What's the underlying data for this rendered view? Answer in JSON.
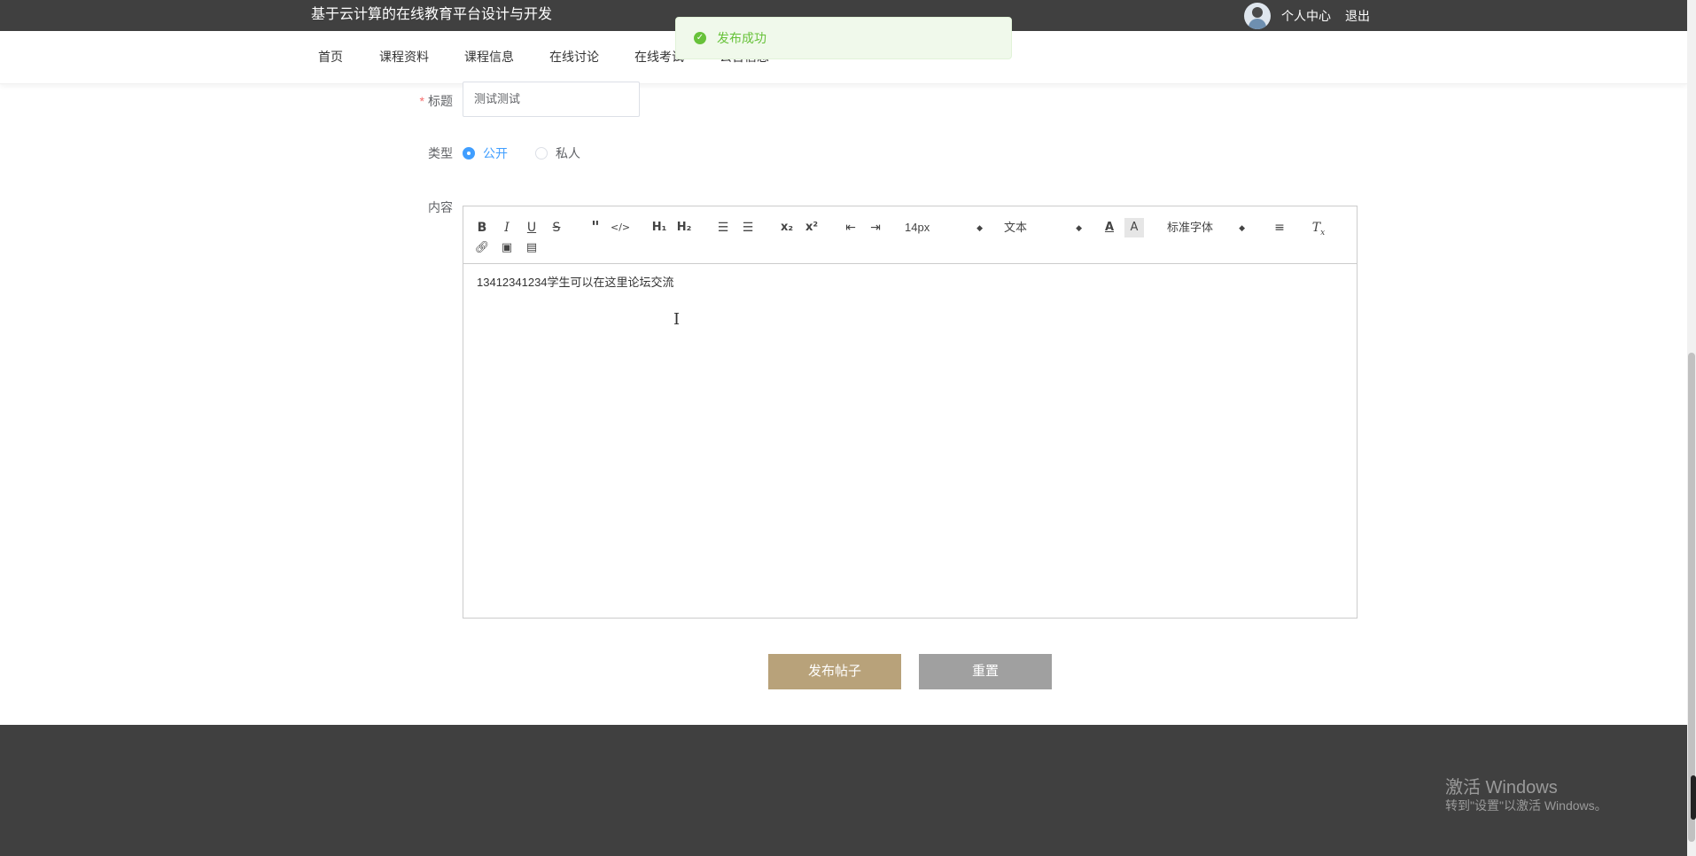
{
  "header": {
    "title": "基于云计算的在线教育平台设计与开发",
    "user_center": "个人中心",
    "logout": "退出"
  },
  "nav": {
    "items": [
      "首页",
      "课程资料",
      "课程信息",
      "在线讨论",
      "在线考试",
      "公告信息"
    ]
  },
  "toast": {
    "message": "发布成功",
    "icon": "check-circle-icon",
    "color": "#67c23a"
  },
  "form": {
    "title_label": "标题",
    "title_value": "测试测试",
    "type_label": "类型",
    "type_options": [
      "公开",
      "私人"
    ],
    "type_selected": "公开",
    "content_label": "内容",
    "content_text": "13412341234学生可以在这里论坛交流"
  },
  "toolbar": {
    "font_size": "14px",
    "heading": "文本",
    "font_family": "标准字体"
  },
  "buttons": {
    "submit": "发布帖子",
    "reset": "重置"
  },
  "watermark": {
    "title": "激活 Windows",
    "subtitle": "转到\"设置\"以激活 Windows。"
  },
  "colors": {
    "header_bg": "#404040",
    "accent": "#409eff",
    "submit_btn": "#b8a27a",
    "reset_btn": "#a0a0a0"
  }
}
